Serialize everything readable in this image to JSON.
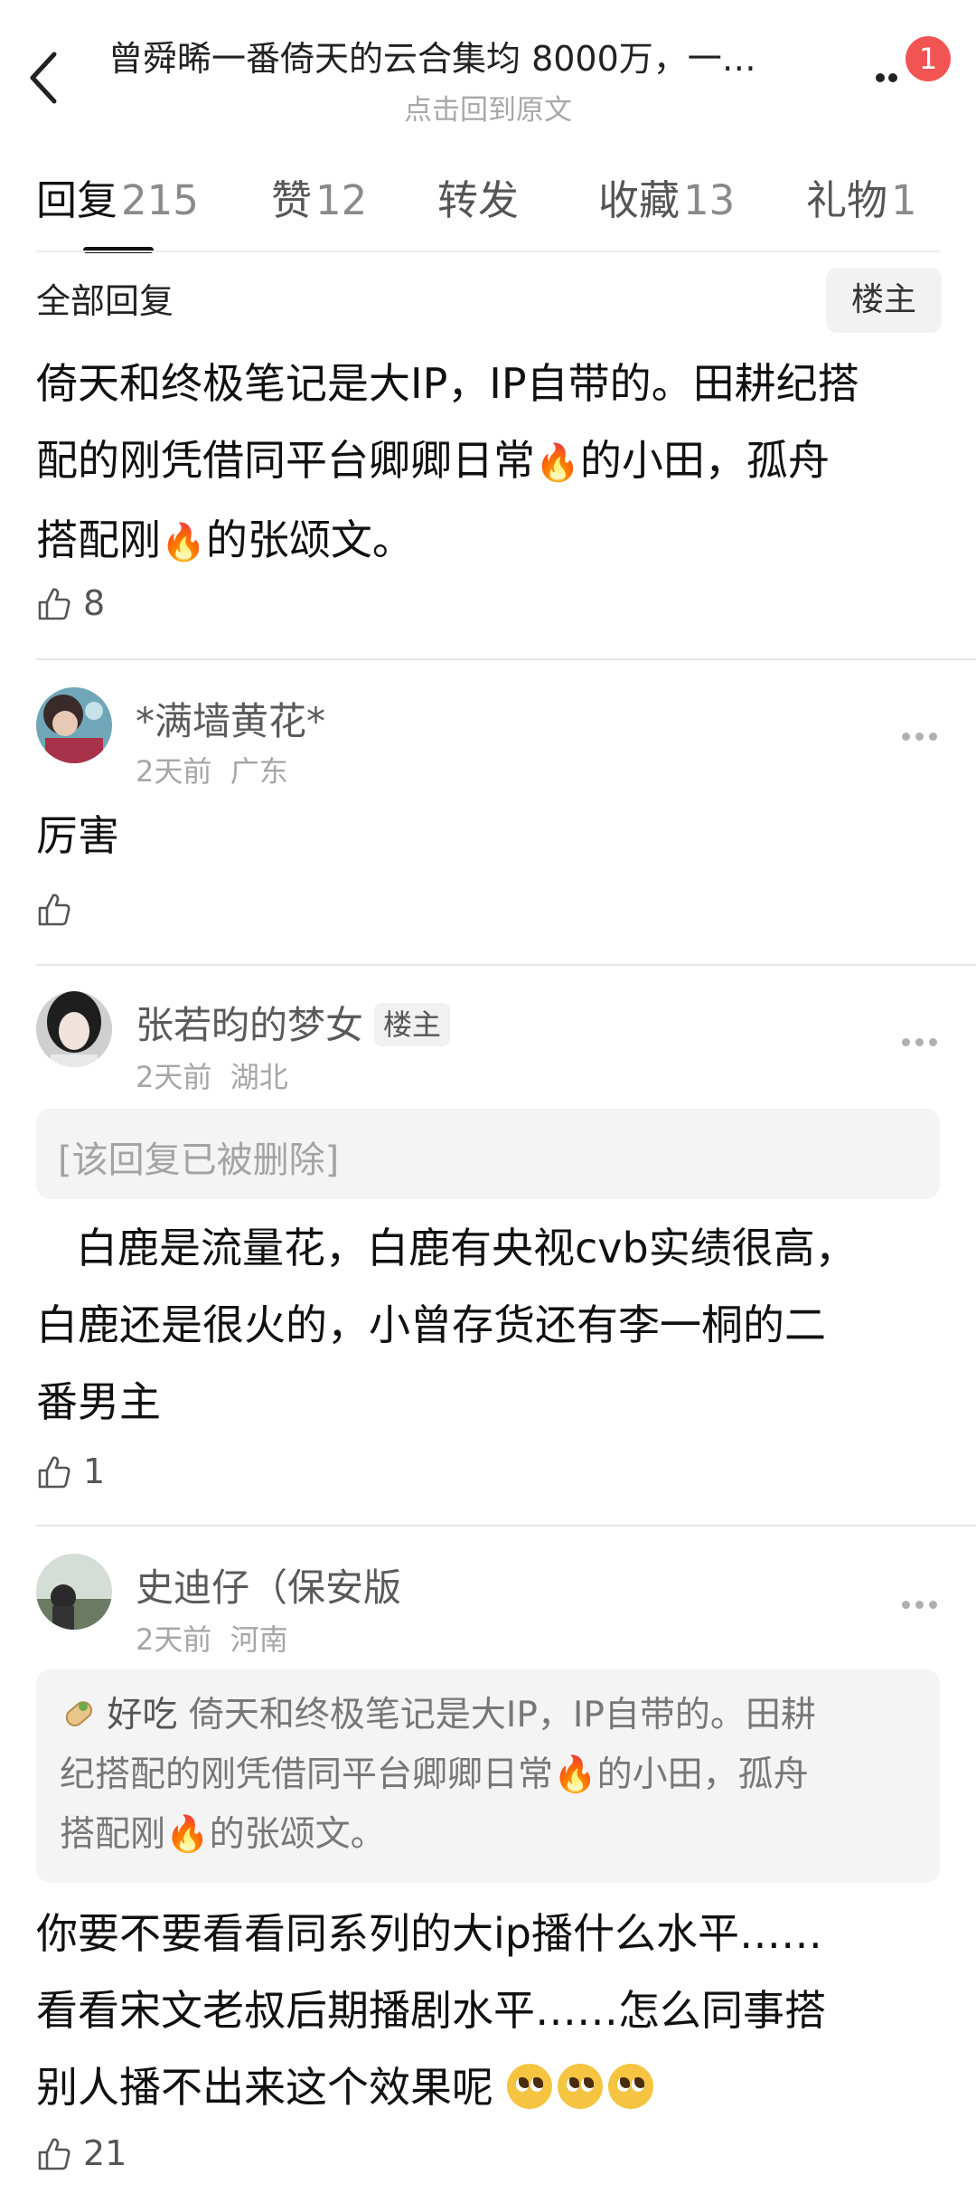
{
  "header": {
    "title": "曾舜晞一番倚天的云合集均 8000万，一…",
    "subtitle": "点击回到原文",
    "notification_count": "1"
  },
  "tabs": [
    {
      "label": "回复",
      "count": "215"
    },
    {
      "label": "赞",
      "count": "12"
    },
    {
      "label": "转发",
      "count": ""
    },
    {
      "label": "收藏",
      "count": "13"
    },
    {
      "label": "礼物",
      "count": "1"
    }
  ],
  "list_header": {
    "title": "全部回复",
    "filter_label": "楼主"
  },
  "post": {
    "line1": "倚天和终极笔记是大IP，IP自带的。田耕纪搭",
    "line2a": "配的刚凭借同平台卿卿日常",
    "fire": "🔥",
    "line2b": "的小田，孤舟",
    "line3a": "搭配刚",
    "line3b": "的张颂文。",
    "likes": "8"
  },
  "comments": [
    {
      "user": "*满墙黄花*",
      "time": "2天前",
      "location": "广东",
      "text": "厉害",
      "likes": ""
    },
    {
      "user": "张若昀的梦女",
      "tag": "楼主",
      "time": "2天前",
      "location": "湖北",
      "deleted_notice": "[该回复已被删除]",
      "line1": "白鹿是流量花，白鹿有央视cvb实绩很高，",
      "line2": "白鹿还是很火的，小曾存货还有李一桐的二",
      "line3": "番男主",
      "likes": "1"
    },
    {
      "user": "史迪仔（保安版",
      "time": "2天前",
      "location": "河南",
      "quote_user": "好吃",
      "quote_line1": "倚天和终极笔记是大IP，IP自带的。田耕",
      "quote_line2a": "纪搭配的刚凭借同平台卿卿日常",
      "quote_line2b": "的小田，孤舟",
      "quote_line3a": "搭配刚",
      "quote_line3b": "的张颂文。",
      "line1": "你要不要看看同系列的大ip播什么水平……",
      "line2": "看看宋文老叔后期播剧水平……怎么同事搭",
      "line3": "别人播不出来这个效果呢",
      "likes": "21"
    }
  ]
}
